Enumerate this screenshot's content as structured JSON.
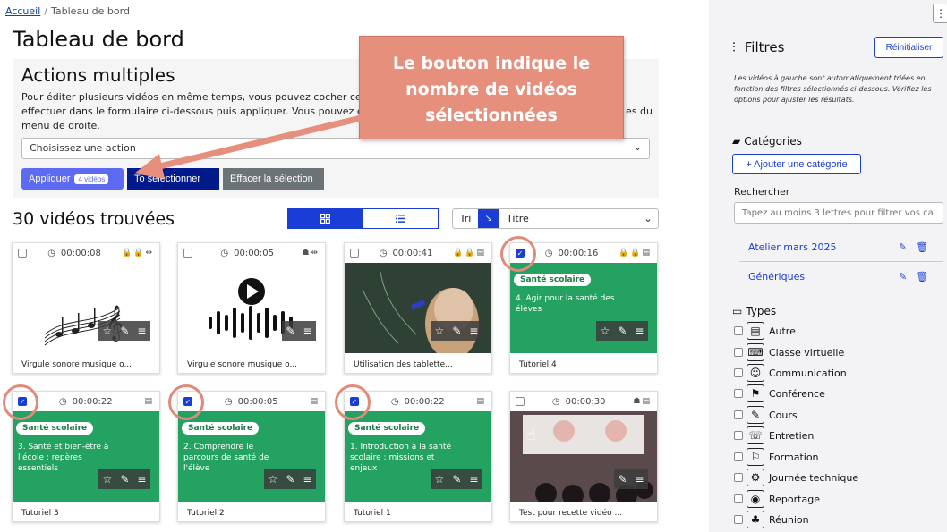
{
  "breadcrumb": {
    "home": "Accueil",
    "separator": "/",
    "current": "Tableau de bord"
  },
  "page_title": "Tableau de bord",
  "actions": {
    "title": "Actions multiples",
    "description_part1": "Pour éditer plusieurs vidéos en même temps, vous pouvez cocher celles q",
    "description_part2": "effectuer dans le formulaire ci-dessous puis appliquer. Vous pouvez égale",
    "description_part2b": "es du",
    "description_part3": "menu de droite.",
    "select_placeholder": "Choisissez une action",
    "apply_label": "Appliquer",
    "apply_badge": "4 vidéos",
    "select_all_label": "Tout sélectionner",
    "select_all_visible": "To   sélectionner",
    "clear_label": "Effacer la sélection"
  },
  "results": {
    "count_label": "30 vidéos trouvées",
    "view_grid_icon": "grid-icon",
    "view_list_icon": "list-icon",
    "sort_label": "Tri",
    "sort_dir_icon": "↘",
    "sort_field": "Titre"
  },
  "callout": {
    "line1": "Le bouton indique le",
    "line2": "nombre de vidéos",
    "line3": "sélectionnées",
    "color": "#e58f7c"
  },
  "videos": [
    {
      "duration": "00:00:08",
      "title": "Virgule sonore musique o...",
      "checked": false,
      "tags": "🔒🔒⇹",
      "thumb": "music"
    },
    {
      "duration": "00:00:05",
      "title": "Virgule sonore musique o...",
      "checked": false,
      "tags": "☗⇹",
      "thumb": "audio"
    },
    {
      "duration": "00:00:41",
      "title": "Utilisation des tablette...",
      "checked": false,
      "tags": "🔒🔒▤",
      "thumb": "photo"
    },
    {
      "duration": "00:00:16",
      "title": "Tutoriel 4",
      "checked": true,
      "tags": "🔒🔒▤",
      "thumb": "green",
      "pill": "Santé scolaire",
      "text": "4. Agir pour la santé des élèves"
    },
    {
      "duration": "00:00:22",
      "title": "Tutoriel 3",
      "checked": true,
      "tags": "▤",
      "thumb": "green",
      "pill": "Santé scolaire",
      "text": "3. Santé et bien-être à l'école : repères essentiels"
    },
    {
      "duration": "00:00:05",
      "title": "Tutoriel 2",
      "checked": true,
      "tags": "▤",
      "thumb": "green",
      "pill": "Santé scolaire",
      "text": "2. Comprendre le parcours de santé de l'élève"
    },
    {
      "duration": "00:00:22",
      "title": "Tutoriel 1",
      "checked": true,
      "tags": "▤",
      "thumb": "green",
      "pill": "Santé scolaire",
      "text": "1. Introduction à la santé scolaire : missions et enjeux"
    },
    {
      "duration": "00:00:30",
      "title": "Test pour recette vidéo ...",
      "checked": false,
      "tags": "☗▤",
      "thumb": "room"
    }
  ],
  "filters": {
    "title": "Filtres",
    "reset_label": "Réinitialiser",
    "help": "Les vidéos à gauche sont automatiquement triées en fonction des filtres sélectionnés ci-dessous. Vérifiez les options pour ajuster les résultats.",
    "categories_title": "Catégories",
    "add_category_label": "+ Ajouter une catégorie",
    "search_label": "Rechercher",
    "search_placeholder": "Tapez au moins 3 lettres pour filtrer vos ca",
    "categories": [
      "Atelier mars 2025",
      "Génériques"
    ],
    "types_title": "Types",
    "types": [
      "Autre",
      "Classe virtuelle",
      "Communication",
      "Conférence",
      "Cours",
      "Entretien",
      "Formation",
      "Journée technique",
      "Reportage",
      "Réunion"
    ]
  }
}
